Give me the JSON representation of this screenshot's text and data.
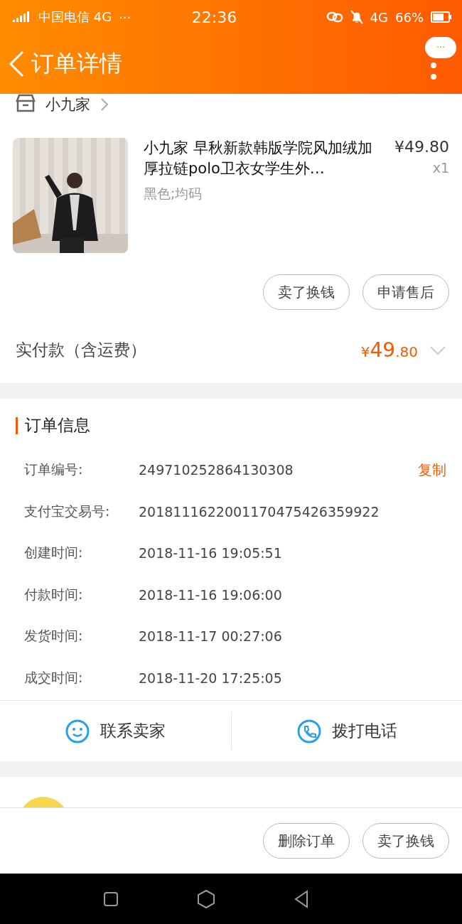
{
  "status_bar": {
    "carrier": "中国电信 4G",
    "more": "···",
    "time": "22:36",
    "network": "4G",
    "battery": "66%"
  },
  "header": {
    "title": "订单详情",
    "menu": "···"
  },
  "store": {
    "name": "小九家"
  },
  "item": {
    "kind": "picture",
    "title": "小九家 早秋新款韩版学院风加绒加厚拉链polo卫衣女学生外…",
    "spec": "黑色;均码",
    "price": "¥49.80",
    "quantity": "x1",
    "actions": [
      "卖了换钱",
      "申请售后"
    ]
  },
  "payment": {
    "label": "实付款（含运费）",
    "currency": "¥",
    "amount_int": "49",
    "amount_dec": ".80"
  },
  "order_info": {
    "title": "订单信息",
    "copy": "复制",
    "rows": [
      {
        "label": "订单编号:",
        "value": "249710252864130308"
      },
      {
        "label": "支付宝交易号:",
        "value": "2018111622001170475426359922"
      },
      {
        "label": "创建时间:",
        "value": "2018-11-16 19:05:51"
      },
      {
        "label": "付款时间:",
        "value": "2018-11-16 19:06:00"
      },
      {
        "label": "发货时间:",
        "value": "2018-11-17 00:27:06"
      },
      {
        "label": "成交时间:",
        "value": "2018-11-20 17:25:05"
      }
    ]
  },
  "contact": [
    {
      "kind": "chat",
      "label": "联系卖家"
    },
    {
      "kind": "phone",
      "label": "拨打电话"
    }
  ],
  "bottom_actions": [
    "删除订单",
    "卖了换钱"
  ]
}
